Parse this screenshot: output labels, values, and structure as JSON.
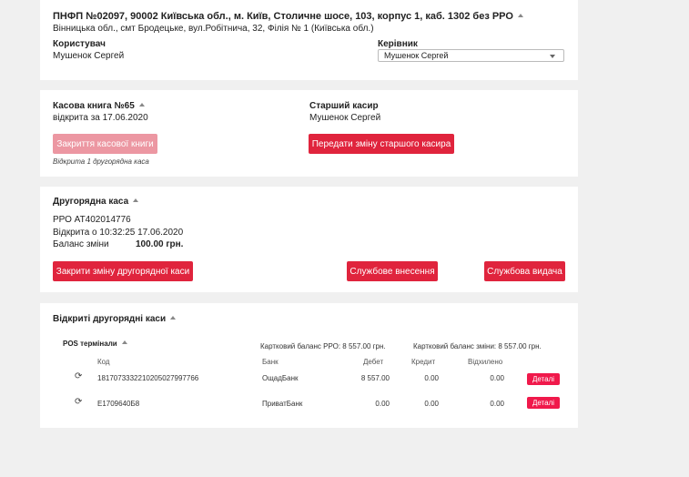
{
  "header": {
    "title": "ПНФП №02097, 90002 Київська обл., м. Київ, Столичне шосе, 103, корпус 1, каб. 1302 без РРО",
    "address": "Вінницька обл., смт Бродецьке, вул.Робітнича, 32, Філія № 1 (Київська обл.)",
    "user_label": "Користувач",
    "user_value": "Мушенок Сергей",
    "manager_label": "Керівник",
    "manager_selected": "Мушенок Сергей"
  },
  "cashbook": {
    "title": "Касова книга №65",
    "opened": "відкрита за 17.06.2020",
    "close_button": "Закриття касової книги",
    "note": "Відкрита 1 другорядна каса",
    "senior_label": "Старший касир",
    "senior_value": "Мушенок Сергей",
    "transfer_button": "Передати зміну старшого касира"
  },
  "secondary": {
    "title": "Другорядна каса",
    "rro": "РРО АТ402014776",
    "opened_at": "Відкрита о 10:32:25 17.06.2020",
    "balance_label": "Баланс зміни",
    "balance_value": "100.00 грн.",
    "close_button": "Закрити зміну другорядної каси",
    "deposit_button": "Службове внесення",
    "withdraw_button": "Службова видача"
  },
  "open_cashes": {
    "title": "Відкриті другорядні каси",
    "pos_title": "POS термінали",
    "card_balance_rro": "Картковий баланс РРО: 8 557.00 грн.",
    "card_balance_shift": "Картковий баланс зміни: 8 557.00 грн.",
    "columns": [
      "Код",
      "Банк",
      "Дебет",
      "Кредит",
      "Відхилено"
    ],
    "rows": [
      {
        "code": "1817073332210205027997766",
        "bank": "ОщадБанк",
        "debit": "8 557.00",
        "credit": "0.00",
        "rejected": "0.00",
        "details": "Деталі"
      },
      {
        "code": "Е1709640Б8",
        "bank": "ПриватБанк",
        "debit": "0.00",
        "credit": "0.00",
        "rejected": "0.00",
        "details": "Деталі"
      }
    ]
  },
  "colors": {
    "accent": "#e0243d",
    "accent_disabled": "#ec97a2",
    "details_button": "#f0194b",
    "background": "#f0f0f0"
  }
}
